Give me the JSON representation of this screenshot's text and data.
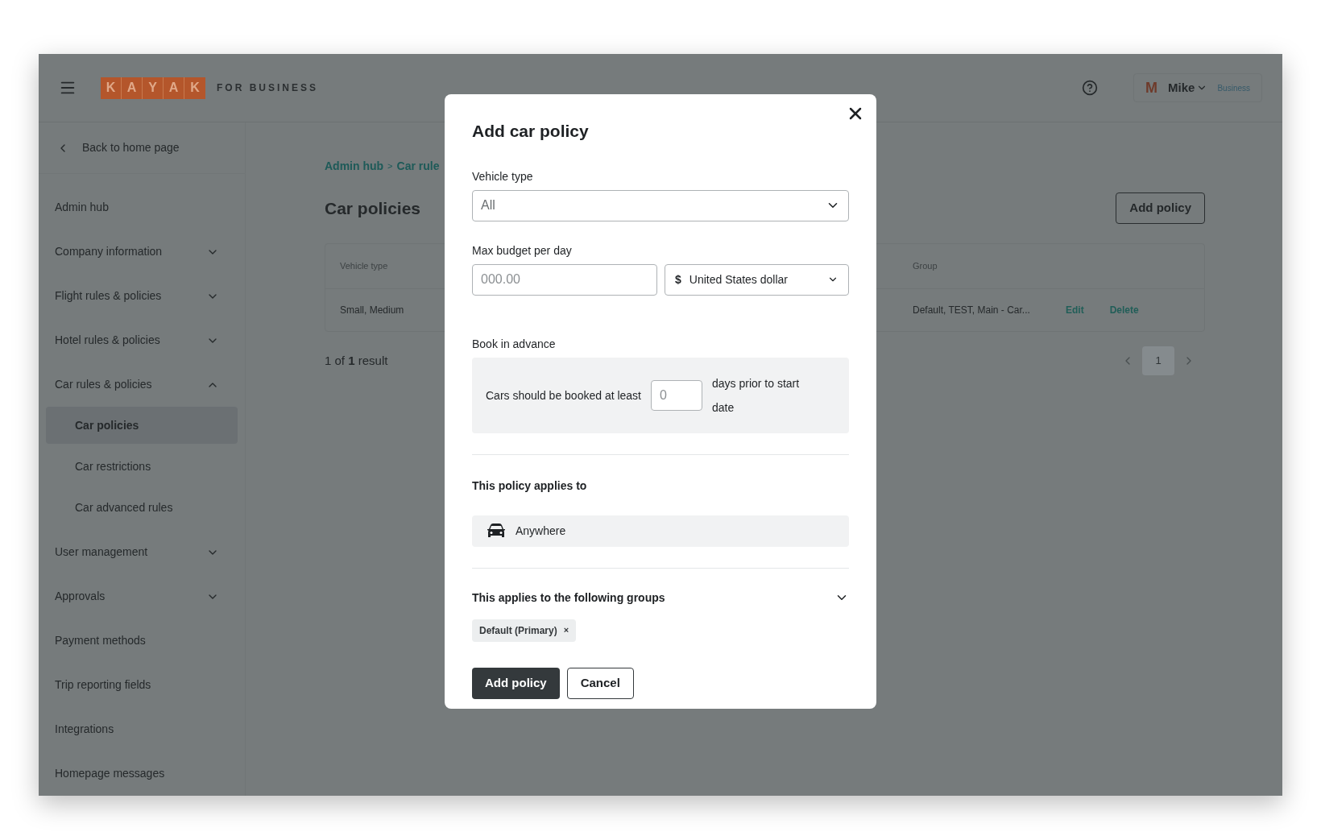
{
  "header": {
    "logo_letters": [
      "K",
      "A",
      "Y",
      "A",
      "K"
    ],
    "logo_suffix": "FOR BUSINESS",
    "user": {
      "initial": "M",
      "name": "Mike",
      "plan": "Business"
    }
  },
  "sidebar": {
    "back_link": "Back to home page",
    "items": [
      {
        "label": "Admin hub",
        "selected": false
      },
      {
        "label": "Company information",
        "selected": false,
        "expanded": false
      },
      {
        "label": "Flight rules & policies",
        "selected": false,
        "expanded": false
      },
      {
        "label": "Hotel rules & policies",
        "selected": false,
        "expanded": false
      },
      {
        "label": "Car rules & policies",
        "selected": false,
        "expanded": true,
        "children": [
          {
            "label": "Car policies",
            "selected": true
          },
          {
            "label": "Car restrictions",
            "selected": false
          },
          {
            "label": "Car advanced rules",
            "selected": false
          }
        ]
      },
      {
        "label": "User management",
        "selected": false,
        "expanded": false
      },
      {
        "label": "Approvals",
        "selected": false,
        "expanded": false
      },
      {
        "label": "Payment methods",
        "selected": false
      },
      {
        "label": "Trip reporting fields",
        "selected": false
      },
      {
        "label": "Integrations",
        "selected": false
      },
      {
        "label": "Homepage messages",
        "selected": false
      }
    ]
  },
  "breadcrumb": {
    "separator": ">",
    "items": [
      "Admin hub",
      "Car rule"
    ]
  },
  "page_title": "Car policies",
  "add_button": "Add policy",
  "table": {
    "columns": [
      "Vehicle type",
      "Group"
    ],
    "rows": [
      {
        "vehicle_type": "Small, Medium",
        "group": "Default, TEST, Main - Car...",
        "actions": [
          "Edit",
          "Delete"
        ]
      }
    ]
  },
  "result_count": "1 of **1** result",
  "pagination": {
    "pages": [
      {
        "label": "1",
        "selected": true
      }
    ]
  },
  "dialog": {
    "title": "Add car policy",
    "vehicle_type": {
      "label": "Vehicle type",
      "value": "All"
    },
    "budget": {
      "label": "Max budget per day",
      "placeholder": "000.00",
      "currency_symbol": "$",
      "currency": "United States dollar"
    },
    "advance": {
      "label": "Book in advance",
      "before": "Cars should be booked at least",
      "placeholder": "0",
      "after": "days prior to start date"
    },
    "applies_to": {
      "heading": "This policy applies to",
      "value": "Anywhere"
    },
    "groups": {
      "heading": "This applies to the following groups",
      "expanded": false,
      "chips": [
        "Default (Primary)"
      ],
      "chip_remove": "×"
    },
    "buttons": [
      {
        "label": "Add policy",
        "kind": "primary"
      },
      {
        "label": "Cancel",
        "kind": "secondary"
      }
    ]
  }
}
